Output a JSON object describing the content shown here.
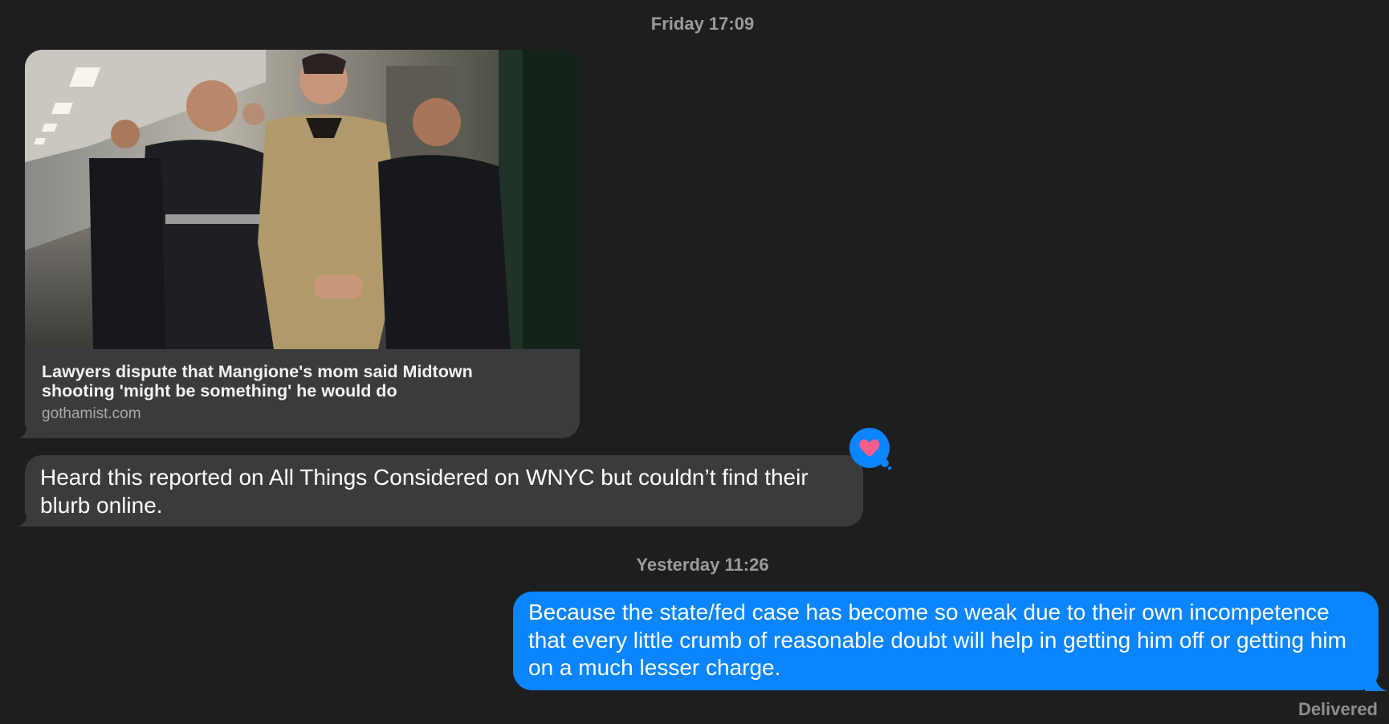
{
  "conversation": {
    "timestamp_1": "Friday 17:09",
    "link_preview": {
      "title": "Lawyers dispute that Mangione's mom said Midtown shooting 'might be something' he would do",
      "domain": "gothamist.com",
      "image_icon": "news-photo"
    },
    "incoming_message": "Heard this reported on All Things Considered on WNYC but couldn’t find their blurb online.",
    "tapback": {
      "icon": "heart-icon",
      "color": "#ff5c8a"
    },
    "timestamp_2": "Yesterday 11:26",
    "outgoing_message": "Because the state/fed case has become so weak due to their own incompetence that every little crumb of reasonable doubt will help in getting him off or getting him on a much lesser charge.",
    "status": "Delivered"
  },
  "colors": {
    "background": "#1e1e1e",
    "incoming_bubble": "#3b3b3d",
    "outgoing_bubble": "#0a84ff",
    "timestamp": "#9b9b9b"
  }
}
